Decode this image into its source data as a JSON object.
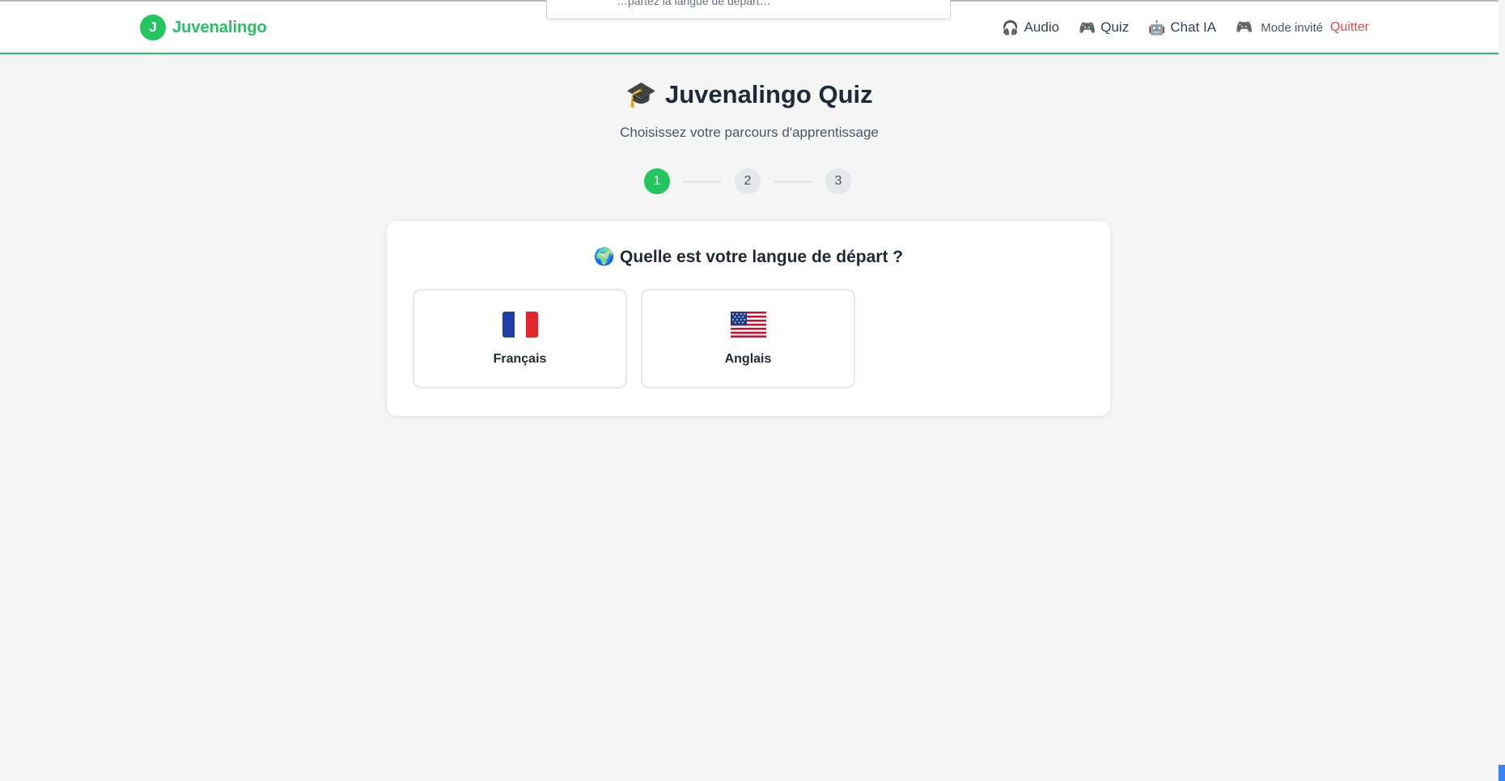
{
  "brand": {
    "logo_letter": "J",
    "name": "Juvenalingo"
  },
  "nav": {
    "links": [
      {
        "icon": "headphones-icon",
        "glyph": "🎧",
        "label": "Audio"
      },
      {
        "icon": "gamepad-icon",
        "glyph": "🎮",
        "label": "Quiz"
      },
      {
        "icon": "robot-icon",
        "glyph": "🤖",
        "label": "Chat IA"
      }
    ],
    "guest": {
      "icon": "gamepad-icon",
      "glyph": "🎮",
      "label": "Mode invité"
    },
    "quit_label": "Quitter"
  },
  "toast": {
    "text": "…partez la langue de départ…"
  },
  "page": {
    "title_icon": "🎓",
    "title": "Juvenalingo Quiz",
    "subtitle": "Choisissez votre parcours d'apprentissage"
  },
  "stepper": {
    "steps": [
      "1",
      "2",
      "3"
    ],
    "active": 1
  },
  "question": {
    "icon": "🌍",
    "text": "Quelle est votre langue de départ ?",
    "options": [
      {
        "flag": "fr",
        "label": "Français"
      },
      {
        "flag": "us",
        "label": "Anglais"
      }
    ]
  },
  "colors": {
    "accent": "#22c55e",
    "danger": "#ef4444",
    "background": "#f5f5f5"
  }
}
